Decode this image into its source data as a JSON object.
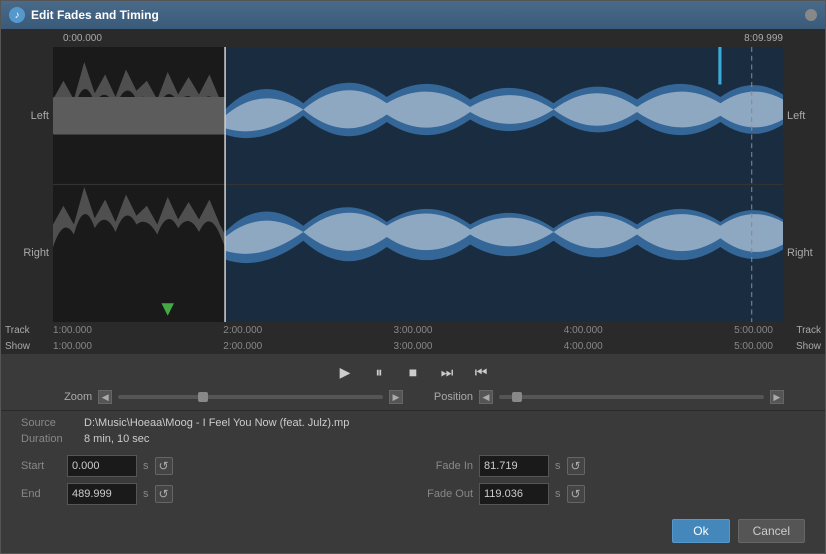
{
  "window": {
    "title": "Edit Fades and Timing",
    "icon": "♪"
  },
  "waveform": {
    "time_start": "0:00.000",
    "time_end": "8:09.999",
    "channel_left": "Left",
    "channel_right": "Right",
    "track_label": "Track",
    "show_label": "Show",
    "ruler_ticks": [
      "1:00.000",
      "2:00.000",
      "3:00.000",
      "4:00.000",
      "5:00.000"
    ],
    "show_ticks": [
      "1:00.000",
      "2:00.000",
      "3:00.000",
      "4:00.000",
      "5:00.000"
    ]
  },
  "controls": {
    "play_label": "▶",
    "pause_label": "⏸",
    "stop_label": "■",
    "next_label": "⏭",
    "prev_label": "⏮",
    "zoom_label": "Zoom",
    "position_label": "Position"
  },
  "source": {
    "label": "Source",
    "value": "D:\\Music\\Hoeaa\\Moog - I Feel You Now (feat. Julz).mp",
    "duration_label": "Duration",
    "duration_value": "8 min, 10 sec"
  },
  "params": {
    "start_label": "Start",
    "start_value": "0.000",
    "start_unit": "s",
    "end_label": "End",
    "end_value": "489.999",
    "end_unit": "s",
    "fade_in_label": "Fade In",
    "fade_in_value": "81.719",
    "fade_in_unit": "s",
    "fade_out_label": "Fade Out",
    "fade_out_value": "119.036",
    "fade_out_unit": "s"
  },
  "buttons": {
    "ok_label": "Ok",
    "cancel_label": "Cancel"
  }
}
